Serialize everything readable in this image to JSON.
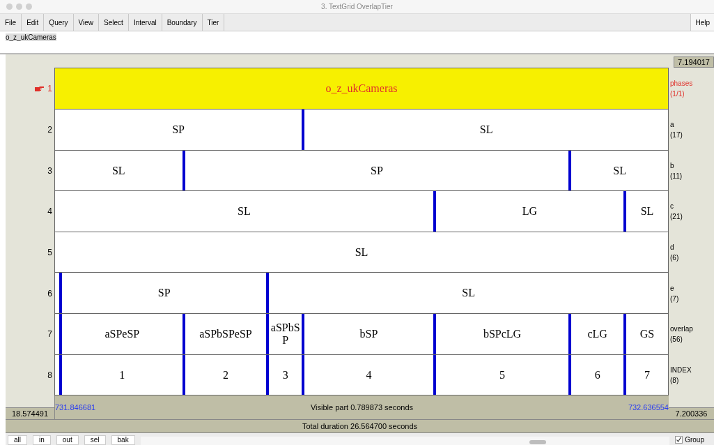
{
  "window": {
    "title": "3. TextGrid OverlapTier"
  },
  "menu": [
    {
      "label": "File"
    },
    {
      "label": "Edit"
    },
    {
      "label": "Query"
    },
    {
      "label": "View"
    },
    {
      "label": "Select"
    },
    {
      "label": "Interval"
    },
    {
      "label": "Boundary"
    },
    {
      "label": "Tier"
    }
  ],
  "help_menu": "Help",
  "text_field": {
    "value": "o_z_ukCameras"
  },
  "top_time": "7.194017",
  "tiers": [
    {
      "number": "1",
      "name": "phases",
      "count": "(1/1)",
      "selected": true,
      "intervals": [
        {
          "text": "o_z_ukCameras",
          "selected": true
        }
      ]
    },
    {
      "number": "2",
      "name": "a",
      "count": "(17)",
      "selected": false,
      "intervals": [
        {
          "text": "SP",
          "selected": false
        },
        {
          "text": "SL",
          "selected": false
        }
      ]
    },
    {
      "number": "3",
      "name": "b",
      "count": "(11)",
      "selected": false,
      "intervals": [
        {
          "text": "SL",
          "selected": false
        },
        {
          "text": "SP",
          "selected": false
        },
        {
          "text": "SL",
          "selected": false
        }
      ]
    },
    {
      "number": "4",
      "name": "c",
      "count": "(21)",
      "selected": false,
      "intervals": [
        {
          "text": "SL",
          "selected": false
        },
        {
          "text": "LG",
          "selected": false
        },
        {
          "text": "SL",
          "selected": false
        }
      ]
    },
    {
      "number": "5",
      "name": "d",
      "count": "(6)",
      "selected": false,
      "intervals": [
        {
          "text": "SL",
          "selected": false
        }
      ]
    },
    {
      "number": "6",
      "name": "e",
      "count": "(7)",
      "selected": false,
      "intervals": [
        {
          "text": "SP",
          "selected": false
        },
        {
          "text": "SL",
          "selected": false
        }
      ]
    },
    {
      "number": "7",
      "name": "overlap",
      "count": "(56)",
      "selected": false,
      "intervals": [
        {
          "text": "aSPeSP",
          "selected": false
        },
        {
          "text": "aSPbSPeSP",
          "selected": false
        },
        {
          "text": "aSPbSP",
          "selected": false
        },
        {
          "text": "bSP",
          "selected": false
        },
        {
          "text": "bSPcLG",
          "selected": false
        },
        {
          "text": "cLG",
          "selected": false
        },
        {
          "text": "GS",
          "selected": false
        }
      ]
    },
    {
      "number": "8",
      "name": "INDEX",
      "count": "(8)",
      "selected": false,
      "intervals": [
        {
          "text": "1",
          "selected": false
        },
        {
          "text": "2",
          "selected": false
        },
        {
          "text": "3",
          "selected": false
        },
        {
          "text": "4",
          "selected": false
        },
        {
          "text": "5",
          "selected": false
        },
        {
          "text": "6",
          "selected": false
        },
        {
          "text": "7",
          "selected": false
        }
      ]
    }
  ],
  "view_start": "731.846681",
  "visible_part": "Visible part 0.789873 seconds",
  "view_end": "732.636554",
  "left_time": "18.574491",
  "right_time": "7.200336",
  "total_duration": "Total duration 26.564700 seconds",
  "buttons": [
    {
      "label": "all"
    },
    {
      "label": "in"
    },
    {
      "label": "out"
    },
    {
      "label": "sel"
    },
    {
      "label": "bak"
    }
  ],
  "group_checkbox": {
    "label": "Group",
    "checked": true
  }
}
